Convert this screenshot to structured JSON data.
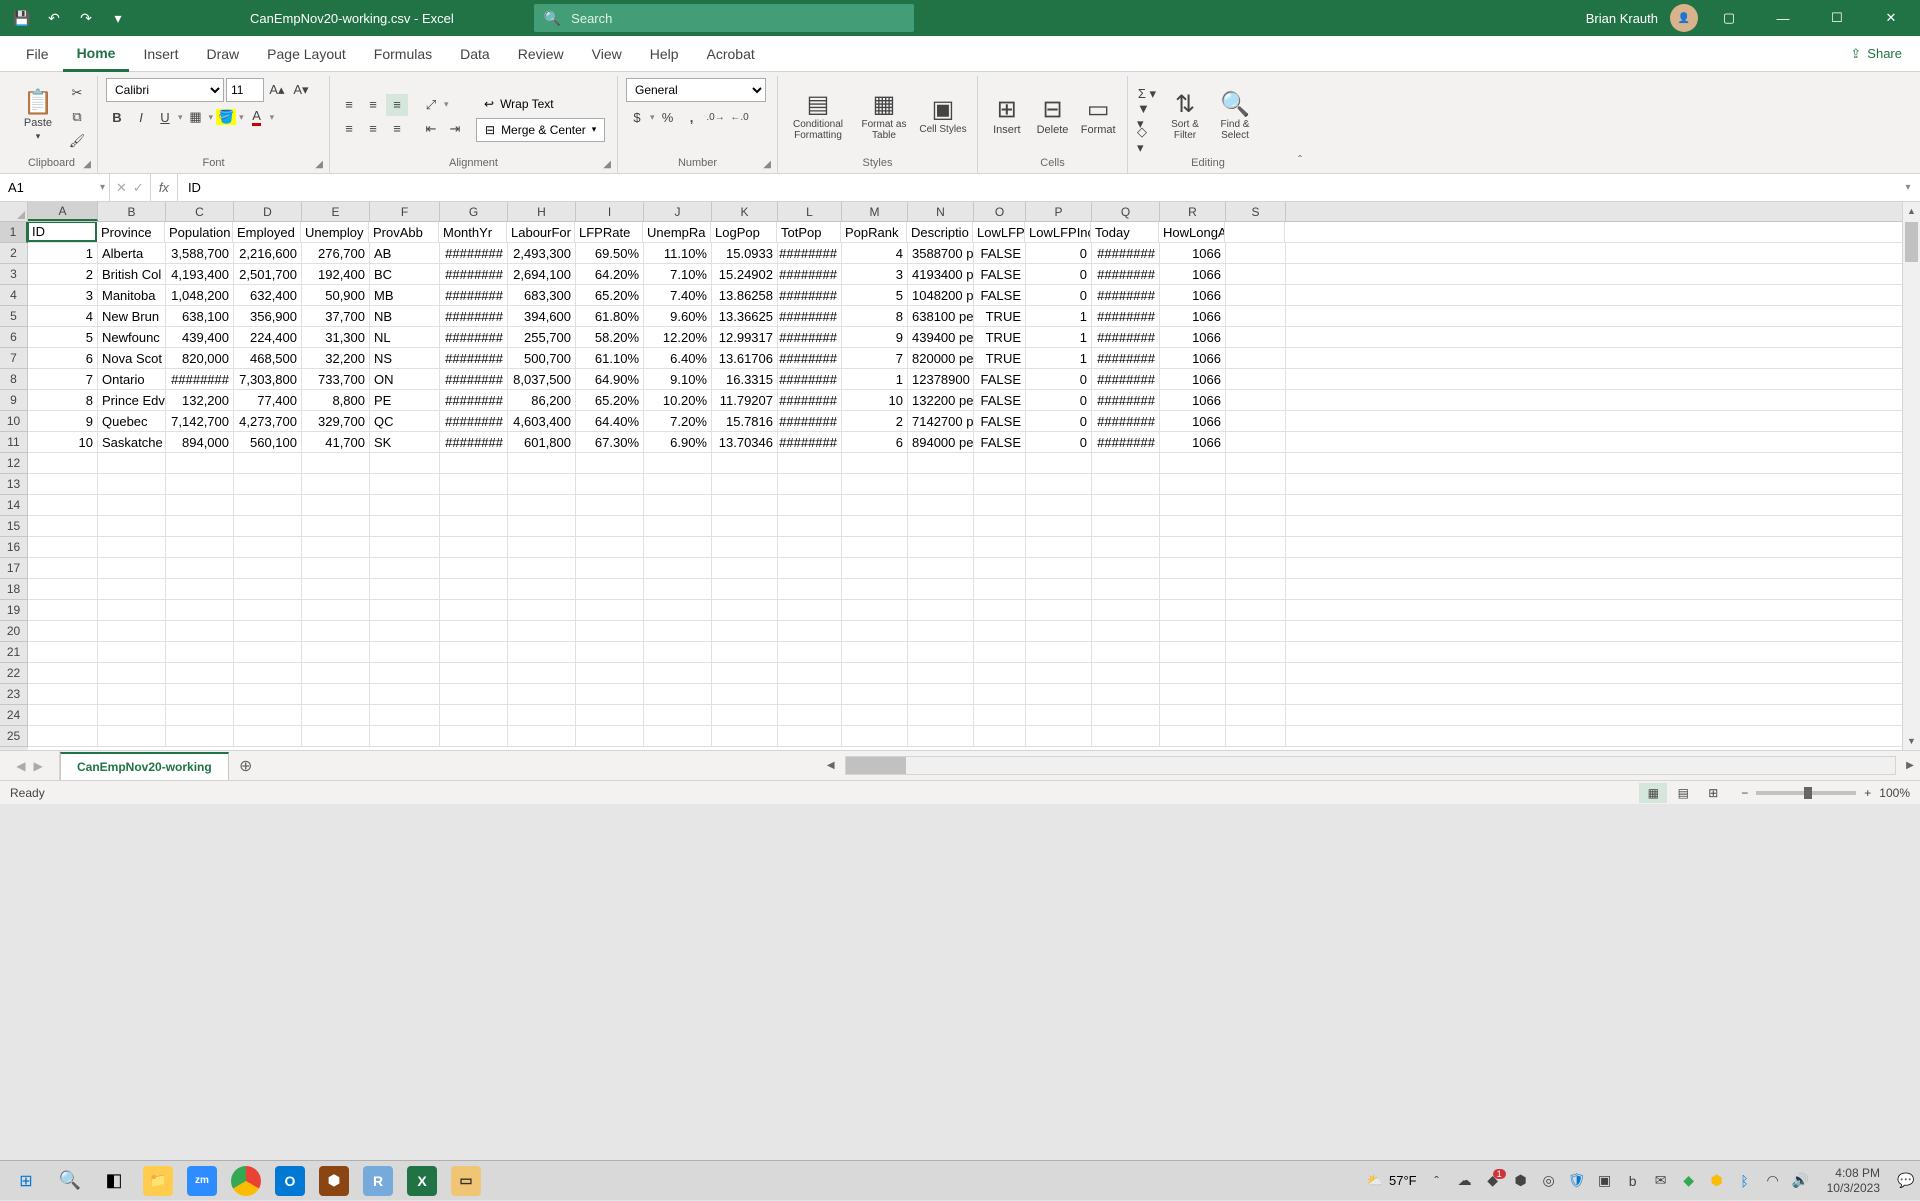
{
  "titlebar": {
    "filename": "CanEmpNov20-working.csv - Excel",
    "search_placeholder": "Search",
    "user": "Brian Krauth"
  },
  "tabs": [
    "File",
    "Home",
    "Insert",
    "Draw",
    "Page Layout",
    "Formulas",
    "Data",
    "Review",
    "View",
    "Help",
    "Acrobat"
  ],
  "active_tab": "Home",
  "share_label": "Share",
  "ribbon": {
    "clipboard": {
      "paste": "Paste",
      "label": "Clipboard"
    },
    "font": {
      "name": "Calibri",
      "size": "11",
      "label": "Font"
    },
    "alignment": {
      "wrap": "Wrap Text",
      "merge": "Merge & Center",
      "label": "Alignment"
    },
    "number": {
      "format": "General",
      "label": "Number"
    },
    "styles": {
      "cond": "Conditional Formatting",
      "table": "Format as Table",
      "cell": "Cell Styles",
      "label": "Styles"
    },
    "cells": {
      "insert": "Insert",
      "delete": "Delete",
      "format": "Format",
      "label": "Cells"
    },
    "editing": {
      "sort": "Sort & Filter",
      "find": "Find & Select",
      "label": "Editing"
    }
  },
  "namebox": "A1",
  "formula": "ID",
  "columns": [
    "A",
    "B",
    "C",
    "D",
    "E",
    "F",
    "G",
    "H",
    "I",
    "J",
    "K",
    "L",
    "M",
    "N",
    "O",
    "P",
    "Q",
    "R",
    "S"
  ],
  "headers": [
    "ID",
    "Province",
    "Population",
    "Employed",
    "Unemploy",
    "ProvAbb",
    "MonthYr",
    "LabourFor",
    "LFPRate",
    "UnempRa",
    "LogPop",
    "TotPop",
    "PopRank",
    "Descriptio",
    "LowLFP",
    "LowLFPInc",
    "Today",
    "HowLongAgo"
  ],
  "rows": [
    [
      "1",
      "Alberta",
      "3,588,700",
      "2,216,600",
      "276,700",
      "AB",
      "########",
      "2,493,300",
      "69.50%",
      "11.10%",
      "15.0933",
      "########",
      "4",
      "3588700 p",
      "FALSE",
      "0",
      "########",
      "1066"
    ],
    [
      "2",
      "British Col",
      "4,193,400",
      "2,501,700",
      "192,400",
      "BC",
      "########",
      "2,694,100",
      "64.20%",
      "7.10%",
      "15.24902",
      "########",
      "3",
      "4193400 p",
      "FALSE",
      "0",
      "########",
      "1066"
    ],
    [
      "3",
      "Manitoba",
      "1,048,200",
      "632,400",
      "50,900",
      "MB",
      "########",
      "683,300",
      "65.20%",
      "7.40%",
      "13.86258",
      "########",
      "5",
      "1048200 p",
      "FALSE",
      "0",
      "########",
      "1066"
    ],
    [
      "4",
      "New Brun",
      "638,100",
      "356,900",
      "37,700",
      "NB",
      "########",
      "394,600",
      "61.80%",
      "9.60%",
      "13.36625",
      "########",
      "8",
      "638100 pe",
      "TRUE",
      "1",
      "########",
      "1066"
    ],
    [
      "5",
      "Newfounc",
      "439,400",
      "224,400",
      "31,300",
      "NL",
      "########",
      "255,700",
      "58.20%",
      "12.20%",
      "12.99317",
      "########",
      "9",
      "439400 pe",
      "TRUE",
      "1",
      "########",
      "1066"
    ],
    [
      "6",
      "Nova Scot",
      "820,000",
      "468,500",
      "32,200",
      "NS",
      "########",
      "500,700",
      "61.10%",
      "6.40%",
      "13.61706",
      "########",
      "7",
      "820000 pe",
      "TRUE",
      "1",
      "########",
      "1066"
    ],
    [
      "7",
      "Ontario",
      "########",
      "7,303,800",
      "733,700",
      "ON",
      "########",
      "8,037,500",
      "64.90%",
      "9.10%",
      "16.3315",
      "########",
      "1",
      "12378900",
      "FALSE",
      "0",
      "########",
      "1066"
    ],
    [
      "8",
      "Prince Edv",
      "132,200",
      "77,400",
      "8,800",
      "PE",
      "########",
      "86,200",
      "65.20%",
      "10.20%",
      "11.79207",
      "########",
      "10",
      "132200 pe",
      "FALSE",
      "0",
      "########",
      "1066"
    ],
    [
      "9",
      "Quebec",
      "7,142,700",
      "4,273,700",
      "329,700",
      "QC",
      "########",
      "4,603,400",
      "64.40%",
      "7.20%",
      "15.7816",
      "########",
      "2",
      "7142700 p",
      "FALSE",
      "0",
      "########",
      "1066"
    ],
    [
      "10",
      "Saskatche",
      "894,000",
      "560,100",
      "41,700",
      "SK",
      "########",
      "601,800",
      "67.30%",
      "6.90%",
      "13.70346",
      "########",
      "6",
      "894000 pe",
      "FALSE",
      "0",
      "########",
      "1066"
    ]
  ],
  "sheet_tab": "CanEmpNov20-working",
  "status": "Ready",
  "zoom": "100%",
  "taskbar": {
    "weather_temp": "57°F",
    "time": "4:08 PM",
    "date": "10/3/2023",
    "notif_count": "1"
  },
  "sym": {
    "dd": "▾",
    "x": "✕",
    "check": "✓",
    "min": "—",
    "max": "☐"
  }
}
